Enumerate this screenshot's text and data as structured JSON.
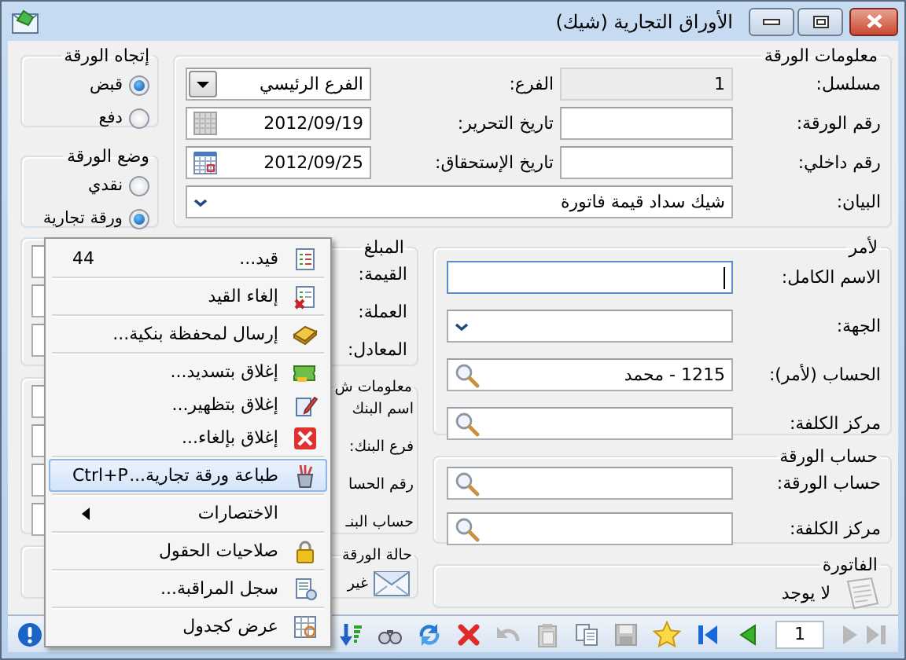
{
  "window": {
    "title": "الأوراق التجارية (شيك)"
  },
  "direction_group": {
    "title": "إتجاه الورقة",
    "options": [
      {
        "label": "قبض",
        "selected": true
      },
      {
        "label": "دفع",
        "selected": false
      }
    ]
  },
  "status_group": {
    "title": "وضع الورقة",
    "options": [
      {
        "label": "نقدي",
        "selected": false
      },
      {
        "label": "ورقة تجارية",
        "selected": true
      }
    ]
  },
  "paper_info": {
    "title": "معلومات الورقة",
    "fields": [
      {
        "label": "مسلسل:",
        "value": "1",
        "kind": "readonly"
      },
      {
        "label": "الفرع:",
        "value": "الفرع الرئيسي",
        "kind": "dropdown"
      },
      {
        "label": "رقم الورقة:",
        "kind": "text",
        "focused": false
      },
      {
        "label": "تاريخ التحرير:",
        "value": "2012/09/19",
        "kind": "date",
        "disabled": true
      },
      {
        "label": "رقم داخلي:",
        "kind": "text",
        "focused": false
      },
      {
        "label": "تاريخ الإستحقاق:",
        "value": "2012/09/25",
        "kind": "date",
        "disabled": false
      }
    ],
    "statement": {
      "label": "البيان:",
      "value": "شيك سداد قيمة فاتورة",
      "kind": "combo"
    }
  },
  "amount": {
    "title": "المبلغ",
    "labels": [
      "القيمة:",
      "العملة:",
      "المعادل:"
    ]
  },
  "order": {
    "title": "لأمر",
    "fields": [
      {
        "label": "الاسم الكامل:",
        "kind": "text",
        "focused": true
      },
      {
        "label": "الجهة:",
        "kind": "combo"
      },
      {
        "label": "الحساب (لأمر):",
        "value": "1215 - محمد",
        "kind": "lookup"
      },
      {
        "label": "مركز الكلفة:",
        "kind": "lookup"
      }
    ]
  },
  "bank_info": {
    "title": "معلومات ش",
    "labels": [
      "اسم البنك",
      "فرع البنك:",
      "رقم الحسا",
      "حساب البنـ"
    ]
  },
  "paper_account": {
    "title": "حساب الورقة",
    "fields": [
      {
        "label": "حساب الورقة:",
        "kind": "lookup"
      },
      {
        "label": "مركز الكلفة:",
        "kind": "lookup"
      }
    ]
  },
  "paper_state": {
    "title": "حالة الورقة",
    "value": "غير"
  },
  "invoice": {
    "title": "الفاتورة",
    "value": "لا يوجد"
  },
  "context_menu": {
    "items": [
      {
        "kind": "item",
        "label": "قيد...",
        "shortcut": "44",
        "selected": false
      },
      {
        "kind": "separator"
      },
      {
        "kind": "item",
        "label": "إلغاء القيد",
        "selected": false
      },
      {
        "kind": "separator"
      },
      {
        "kind": "item",
        "label": "إرسال لمحفظة بنكية...",
        "selected": false
      },
      {
        "kind": "separator"
      },
      {
        "kind": "item",
        "label": "إغلاق بتسديد...",
        "selected": false
      },
      {
        "kind": "item",
        "label": "إغلاق بتظهير...",
        "selected": false
      },
      {
        "kind": "item",
        "label": "إغلاق بإلغاء...",
        "selected": false
      },
      {
        "kind": "separator"
      },
      {
        "kind": "item",
        "label": "طباعة ورقة تجارية...",
        "shortcut": "Ctrl+P",
        "selected": true
      },
      {
        "kind": "separator"
      },
      {
        "kind": "submenu",
        "label": "الاختصارات",
        "selected": false
      },
      {
        "kind": "separator"
      },
      {
        "kind": "item",
        "label": "صلاحيات الحقول",
        "selected": false
      },
      {
        "kind": "separator"
      },
      {
        "kind": "item",
        "label": "سجل المراقبة...",
        "selected": false
      },
      {
        "kind": "separator"
      },
      {
        "kind": "item",
        "label": "عرض كجدول",
        "selected": false
      }
    ]
  },
  "toolbar": {
    "page": "1"
  }
}
